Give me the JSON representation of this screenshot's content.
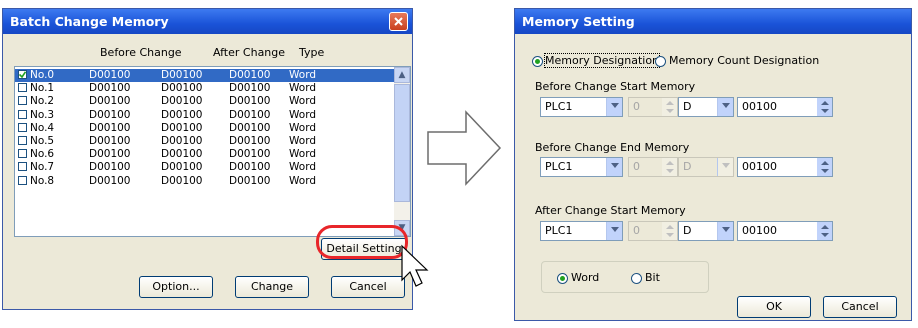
{
  "batch": {
    "title": "Batch Change Memory",
    "columns": [
      "Before Change",
      "After Change",
      "Type"
    ],
    "rows": [
      {
        "no": "No.0",
        "a": "D00100",
        "b": "D00100",
        "c": "D00100",
        "type": "Word",
        "checked": true
      },
      {
        "no": "No.1",
        "a": "D00100",
        "b": "D00100",
        "c": "D00100",
        "type": "Word",
        "checked": false
      },
      {
        "no": "No.2",
        "a": "D00100",
        "b": "D00100",
        "c": "D00100",
        "type": "Word",
        "checked": false
      },
      {
        "no": "No.3",
        "a": "D00100",
        "b": "D00100",
        "c": "D00100",
        "type": "Word",
        "checked": false
      },
      {
        "no": "No.4",
        "a": "D00100",
        "b": "D00100",
        "c": "D00100",
        "type": "Word",
        "checked": false
      },
      {
        "no": "No.5",
        "a": "D00100",
        "b": "D00100",
        "c": "D00100",
        "type": "Word",
        "checked": false
      },
      {
        "no": "No.6",
        "a": "D00100",
        "b": "D00100",
        "c": "D00100",
        "type": "Word",
        "checked": false
      },
      {
        "no": "No.7",
        "a": "D00100",
        "b": "D00100",
        "c": "D00100",
        "type": "Word",
        "checked": false
      },
      {
        "no": "No.8",
        "a": "D00100",
        "b": "D00100",
        "c": "D00100",
        "type": "Word",
        "checked": false
      }
    ],
    "detail_setting": "Detail Setting",
    "option": "Option...",
    "change": "Change",
    "cancel": "Cancel"
  },
  "memory": {
    "title": "Memory Setting",
    "radio_designation": "Memory Designation",
    "radio_count": "Memory Count Designation",
    "before_start_label": "Before Change Start Memory",
    "before_end_label": "Before Change End Memory",
    "after_start_label": "After Change Start Memory",
    "plc": "PLC1",
    "station": "0",
    "device": "D",
    "address": "00100",
    "word": "Word",
    "bit": "Bit",
    "ok": "OK",
    "cancel": "Cancel"
  },
  "colors": {
    "accent": "#1a53d8",
    "highlight": "#e8262a",
    "selection": "#316ac5"
  }
}
